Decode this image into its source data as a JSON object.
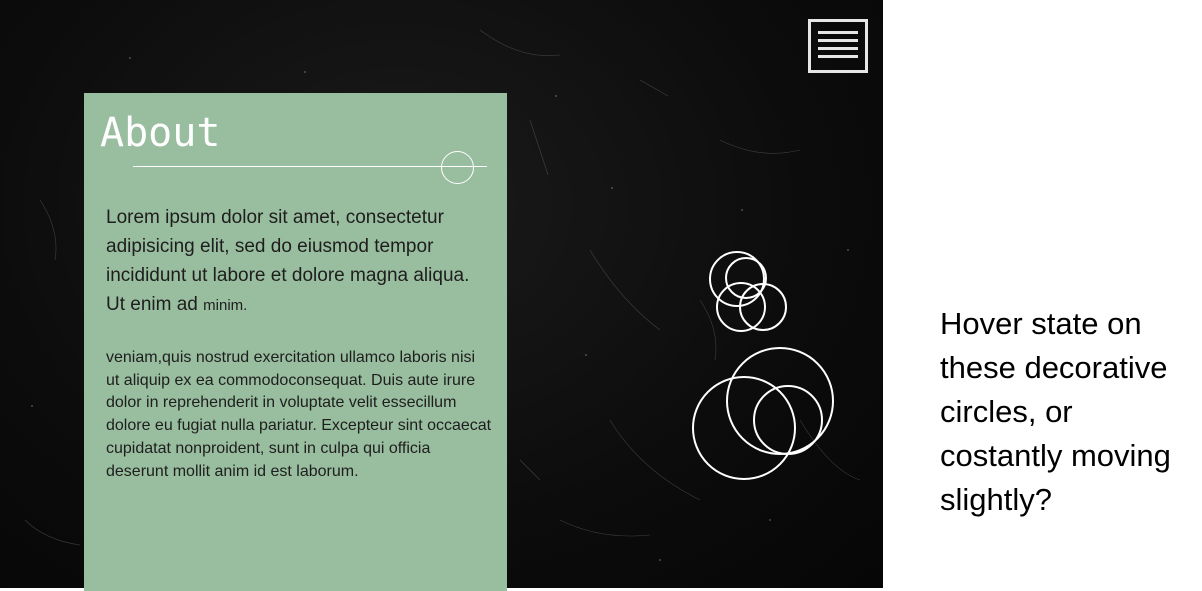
{
  "about": {
    "title": "About",
    "lead_main": "Lorem ipsum dolor sit amet, consectetur adipisicing elit, sed do eiusmod tempor incididunt ut labore et dolore magna aliqua. Ut enim ad ",
    "lead_small": "minim.",
    "body": " veniam,quis nostrud exercitation ullamco laboris nisi ut aliquip ex ea commodoconsequat. Duis aute irure dolor in reprehenderit in voluptate velit essecillum dolore eu fugiat nulla pariatur. Excepteur sint occaecat cupidatat nonproident, sunt in culpa qui officia deserunt mollit anim id est laborum."
  },
  "annotation": {
    "text": "Hover state on\nthese decorative\ncircles, or\ncostantly moving\nslightly?"
  },
  "colors": {
    "background": "#0c0c0c",
    "card": "#99bd9f",
    "line": "#ffffff",
    "menu": "#e6e6e6"
  },
  "icons": {
    "menu": "hamburger-menu-icon"
  }
}
